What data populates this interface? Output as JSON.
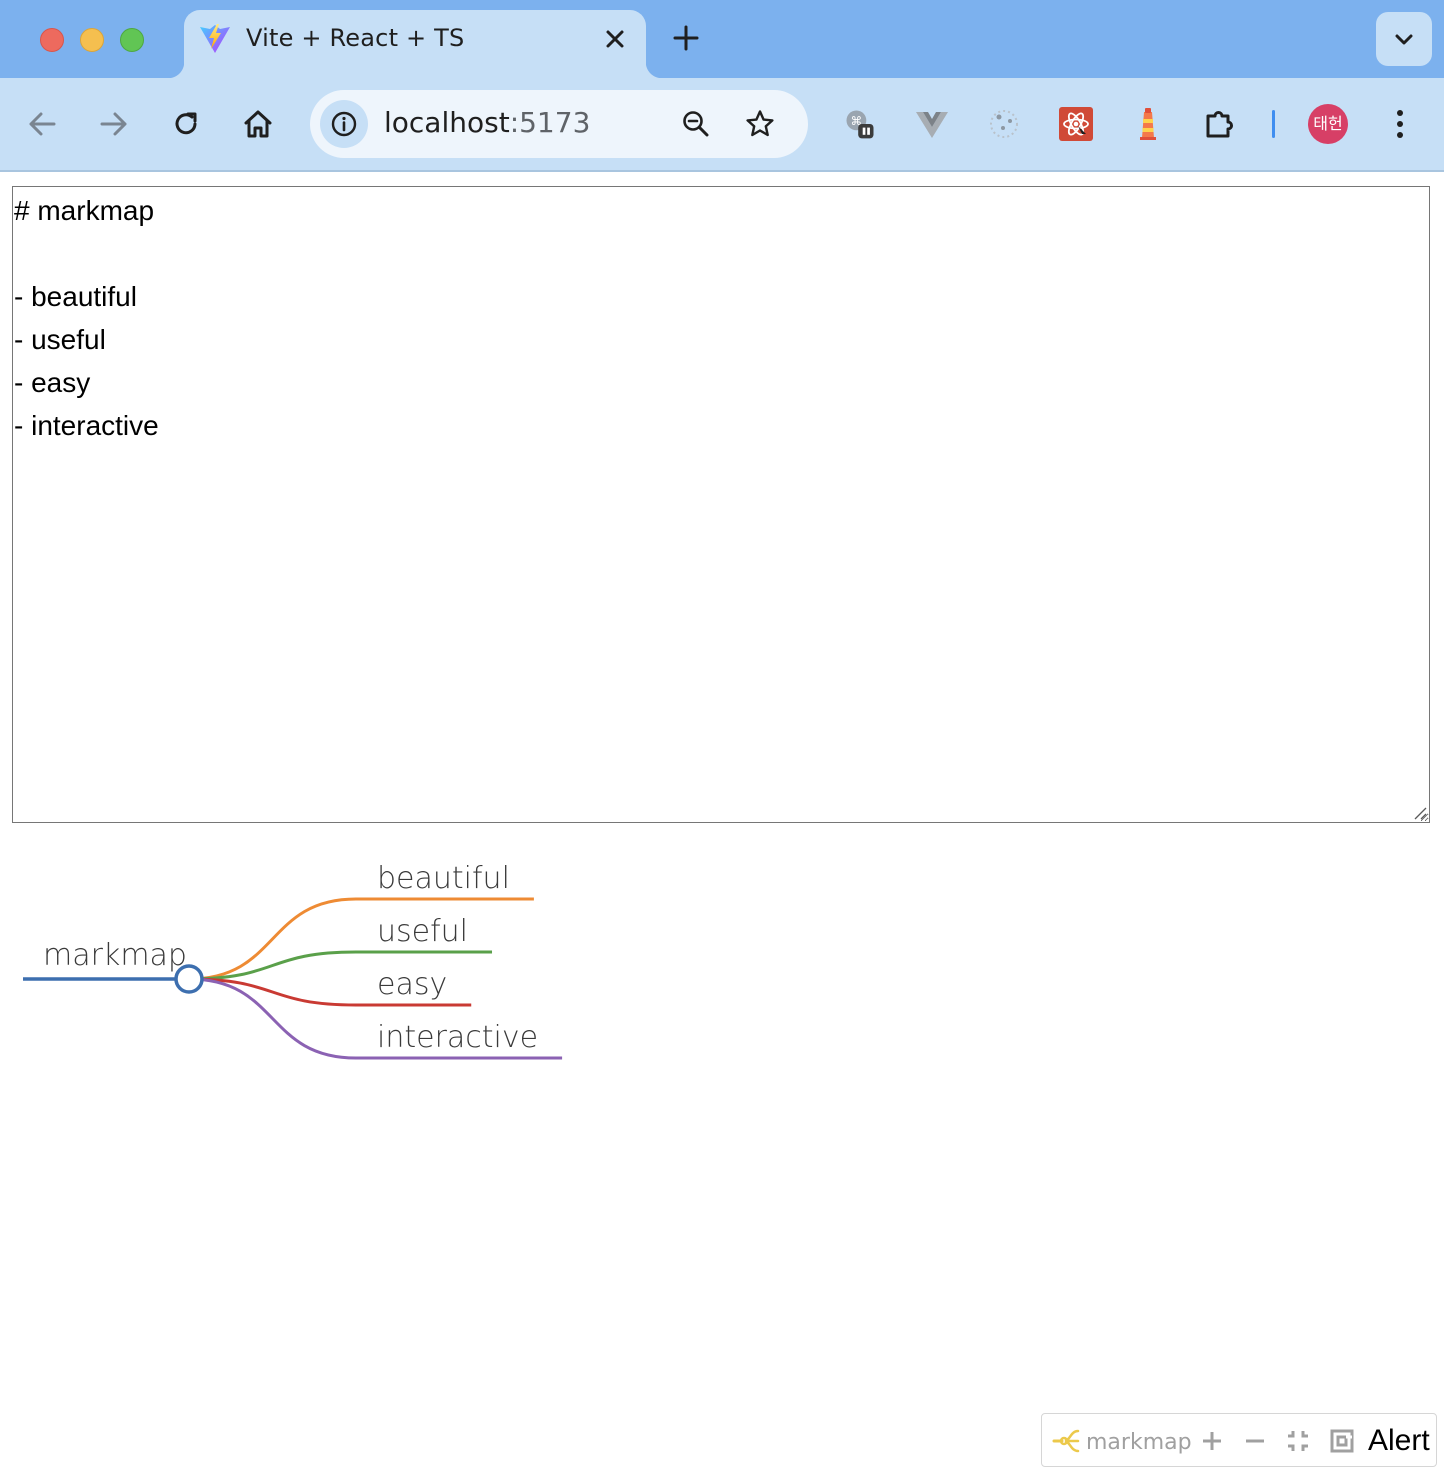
{
  "browser": {
    "tab": {
      "title": "Vite + React + TS",
      "favicon": "vite-logo-icon"
    },
    "address_bar": {
      "host": "localhost",
      "port": ":5173"
    },
    "profile_initials": "태헌",
    "accent_colors": {
      "tabbar": "#7cb1ee",
      "toolbar": "#c6dff6"
    }
  },
  "editor": {
    "content": "# markmap\n\n- beautiful\n- useful\n- easy\n- interactive"
  },
  "mindmap": {
    "root": {
      "label": "markmap",
      "color": "#3d6faf"
    },
    "children": [
      {
        "label": "beautiful",
        "color": "#ee8b34"
      },
      {
        "label": "useful",
        "color": "#5aa04a"
      },
      {
        "label": "easy",
        "color": "#c93a33"
      },
      {
        "label": "interactive",
        "color": "#8b62b3"
      }
    ]
  },
  "mm_toolbar": {
    "brand": "markmap",
    "buttons": [
      "zoom-in-icon",
      "zoom-out-icon",
      "fit-window-icon",
      "recurse-icon"
    ],
    "alert_label": "Alert"
  }
}
